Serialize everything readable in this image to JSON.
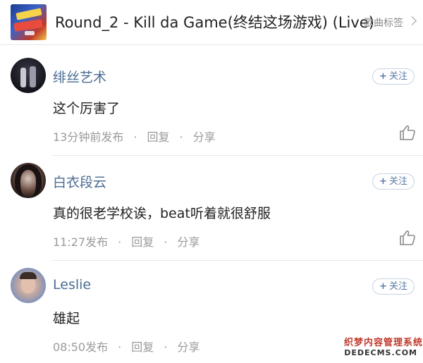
{
  "header": {
    "song_title": "Round_2 - Kill da Game(终结这场游戏) (Live)",
    "tags_label": "歌曲标签"
  },
  "comments": [
    {
      "username": "绯丝艺术",
      "follow_label": "关注",
      "follow_symbol": "+",
      "content": "这个厉害了",
      "time": "13分钟前发布",
      "reply_label": "回复",
      "share_label": "分享",
      "separator": "·"
    },
    {
      "username": "白衣段云",
      "follow_label": "关注",
      "follow_symbol": "+",
      "content": "真的很老学校诶，beat听着就很舒服",
      "time": "11:27发布",
      "reply_label": "回复",
      "share_label": "分享",
      "separator": "·"
    },
    {
      "username": "Leslie",
      "follow_label": "关注",
      "follow_symbol": "+",
      "content": "雄起",
      "time": "08:50发布",
      "reply_label": "回复",
      "share_label": "分享",
      "separator": "·"
    }
  ],
  "watermark": {
    "line1": "织梦内容管理系统",
    "line2": "DEDECMS.COM"
  },
  "colors": {
    "username": "#4a6c93",
    "meta": "#9a9a9a",
    "follow_border": "#c6d3e3",
    "watermark_red": "#c0392b"
  },
  "icons": [
    "album-cover",
    "chevron-right-icon",
    "avatar",
    "plus-icon",
    "thumbs-up-icon"
  ]
}
